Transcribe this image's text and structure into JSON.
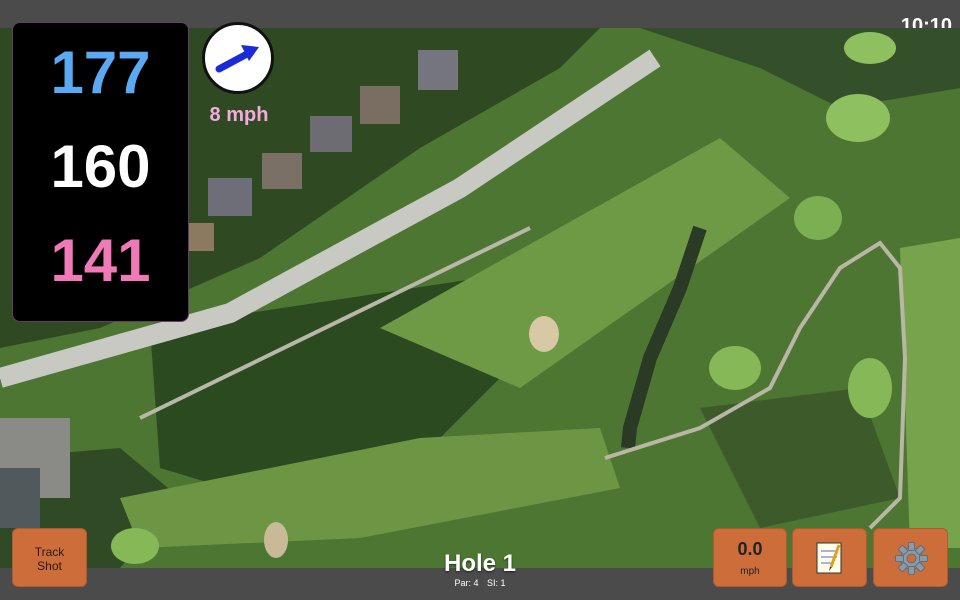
{
  "status_bar": {
    "time": "10:10"
  },
  "distances": {
    "back": "177",
    "middle": "160",
    "front": "141"
  },
  "wind": {
    "speed": "8 mph",
    "icon": "wind-direction-arrow-icon"
  },
  "buttons": {
    "track_shot": {
      "line1": "Track",
      "line2": "Shot"
    },
    "speed": {
      "value": "0.0",
      "unit": "mph"
    },
    "notes": {
      "icon": "notepad-icon"
    },
    "settings": {
      "icon": "gear-icon"
    }
  },
  "hole": {
    "title": "Hole 1",
    "par": "Par: 4",
    "stroke_index": "SI: 1"
  },
  "colors": {
    "back": "#5aa9f2",
    "middle": "#ffffff",
    "front": "#f07ab8",
    "wind_text": "#f6a9df",
    "button": "#cd6d3a",
    "wind_arrow": "#1b2bd8"
  }
}
